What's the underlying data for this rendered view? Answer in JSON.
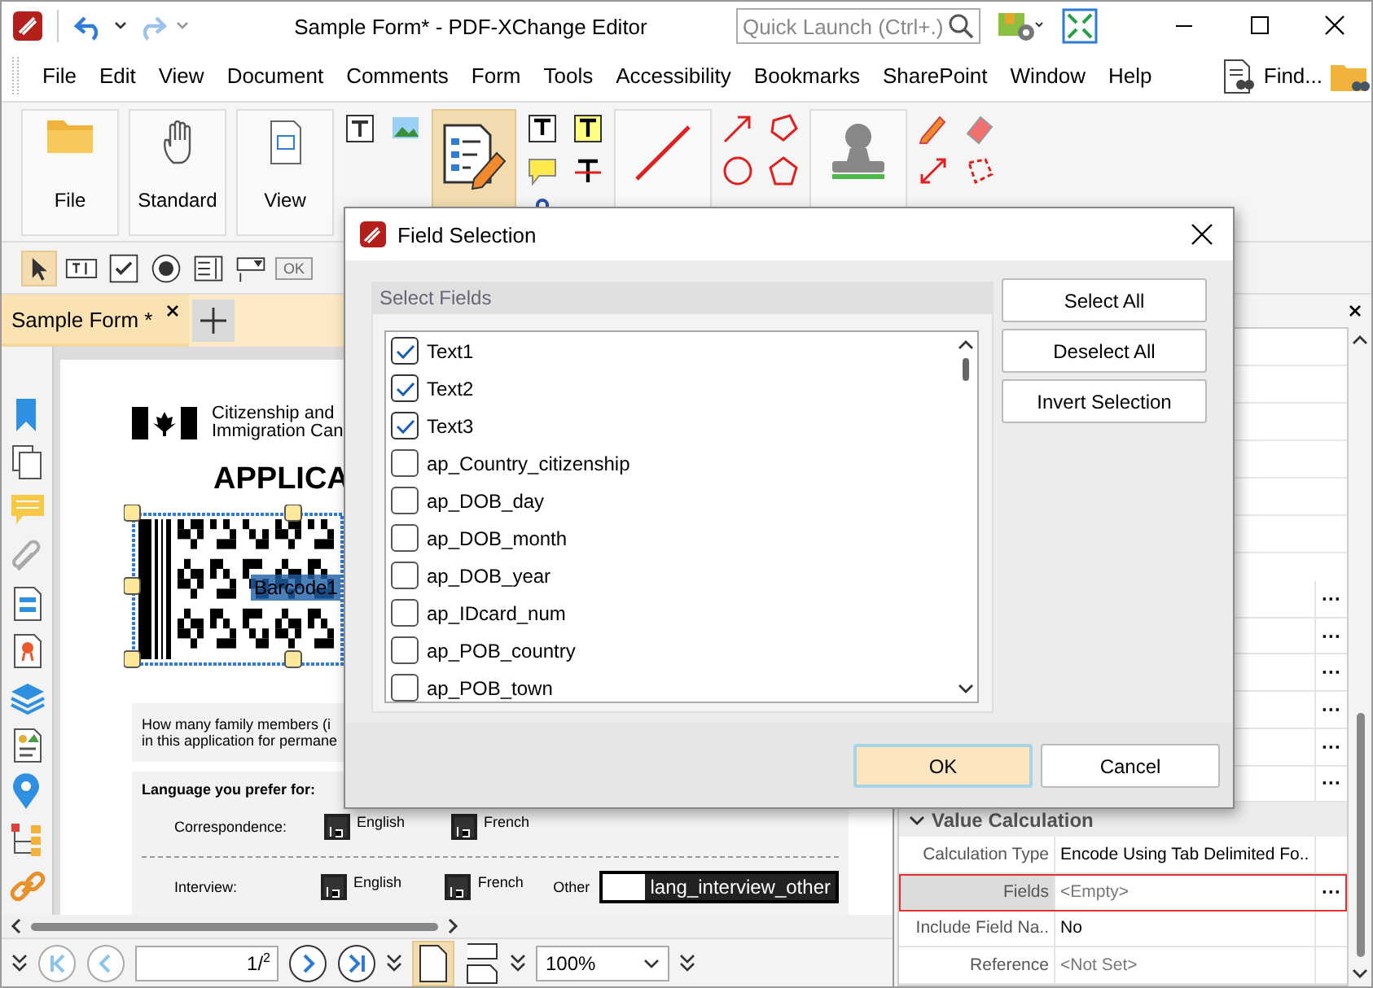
{
  "window": {
    "title": "Sample Form* - PDF-XChange Editor",
    "quick_launch": {
      "placeholder": "Quick Launch (Ctrl+.)"
    }
  },
  "menu": [
    "File",
    "Edit",
    "View",
    "Document",
    "Comments",
    "Form",
    "Tools",
    "Accessibility",
    "Bookmarks",
    "SharePoint",
    "Window",
    "Help"
  ],
  "find": "Find...",
  "ribbon": [
    {
      "label": "File",
      "selected": false
    },
    {
      "label": "Standard",
      "selected": false
    },
    {
      "label": "View",
      "selected": false
    },
    {
      "selected": true
    },
    {
      "selected": false
    },
    {
      "selected": false
    }
  ],
  "form_toolbar": {
    "ok": "OK"
  },
  "document_tab": {
    "label": "Sample Form *",
    "selected": true
  },
  "document": {
    "agency": [
      "Citizenship and",
      "Immigration Can"
    ],
    "heading": "APPLICA",
    "barcode_field": "Barcode1",
    "question": [
      "How many family members (i",
      "in this application for permane"
    ],
    "language_heading": "Language you prefer for:",
    "rows": [
      {
        "label": "Correspondence:",
        "options": [
          "English",
          "French"
        ]
      },
      {
        "label": "Interview:",
        "options": [
          "English",
          "French"
        ],
        "other": "Other",
        "other_field": "lang_interview_other"
      }
    ]
  },
  "navigation": {
    "page": "1",
    "separator": "/",
    "total": "2",
    "zoom": "100%"
  },
  "properties": {
    "section": {
      "title": "Value Calculation",
      "expanded": true
    },
    "covered_rows": [
      {
        "button": "···"
      },
      {
        "button": "···"
      },
      {
        "button": "···"
      },
      {
        "button": "···"
      },
      {
        "button": "···"
      },
      {
        "button": "···"
      }
    ],
    "rows": [
      {
        "label": "Calculation Type",
        "value": "Encode Using Tab Delimited Fo..",
        "unset": false,
        "selected": false
      },
      {
        "label": "Fields",
        "value": "<Empty>",
        "unset": true,
        "selected": true,
        "button": "···"
      },
      {
        "label": "Include Field Na..",
        "value": "No",
        "unset": false,
        "selected": false
      },
      {
        "label": "Reference",
        "value": "<Not Set>",
        "unset": true,
        "selected": false
      }
    ]
  },
  "dialog": {
    "title": "Field Selection",
    "group": "Select Fields",
    "fields": [
      {
        "name": "Text1",
        "checked": true
      },
      {
        "name": "Text2",
        "checked": true
      },
      {
        "name": "Text3",
        "checked": true
      },
      {
        "name": "ap_Country_citizenship",
        "checked": false
      },
      {
        "name": "ap_DOB_day",
        "checked": false
      },
      {
        "name": "ap_DOB_month",
        "checked": false
      },
      {
        "name": "ap_DOB_year",
        "checked": false
      },
      {
        "name": "ap_IDcard_num",
        "checked": false
      },
      {
        "name": "ap_POB_country",
        "checked": false
      },
      {
        "name": "ap_POB_town",
        "checked": false
      }
    ],
    "side_buttons": [
      "Select All",
      "Deselect All",
      "Invert Selection"
    ],
    "buttons": [
      {
        "label": "OK",
        "default": true
      },
      {
        "label": "Cancel",
        "default": false
      }
    ]
  }
}
